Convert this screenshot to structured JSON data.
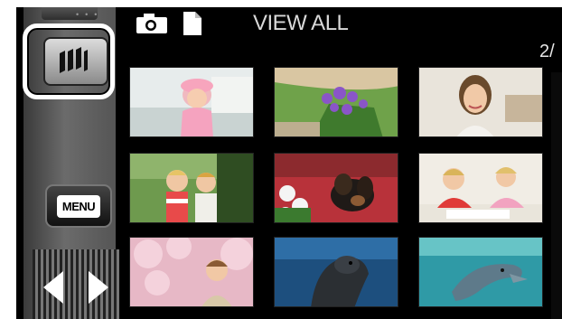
{
  "header": {
    "title": "VIEW ALL",
    "page_indicator": "2/"
  },
  "sidebar": {
    "mode_button_icon": "movie-film-icon",
    "menu_label": "MENU",
    "scroll_left_icon": "triangle-left-icon",
    "scroll_right_icon": "triangle-right-icon"
  },
  "icons": {
    "camera": "camera-icon",
    "file": "document-icon"
  },
  "thumbnails": [
    {
      "subject": "girl-in-pink-hat"
    },
    {
      "subject": "purple-flowers-in-garden"
    },
    {
      "subject": "smiling-woman-portrait"
    },
    {
      "subject": "two-children-on-swing"
    },
    {
      "subject": "puppy-in-flowers"
    },
    {
      "subject": "two-children-drawing"
    },
    {
      "subject": "child-under-cherry-blossoms"
    },
    {
      "subject": "sea-lion-underwater"
    },
    {
      "subject": "dolphin-underwater"
    }
  ],
  "colors": {
    "background": "#000000",
    "title_text": "#d9d9d9",
    "highlight": "#ffffff"
  }
}
